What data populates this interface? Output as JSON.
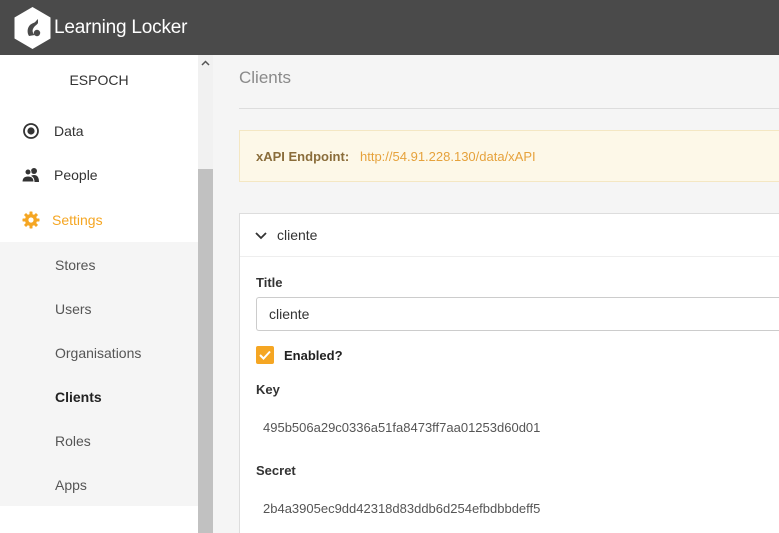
{
  "brand": {
    "name": "Learning Locker"
  },
  "sidebar": {
    "org": "ESPOCH",
    "nav": [
      {
        "label": "Data",
        "icon": "data-icon"
      },
      {
        "label": "People",
        "icon": "people-icon"
      },
      {
        "label": "Settings",
        "icon": "gear-icon"
      }
    ],
    "settings_items": [
      "Stores",
      "Users",
      "Organisations",
      "Clients",
      "Roles",
      "Apps"
    ],
    "current_item": "Clients"
  },
  "main": {
    "title": "Clients",
    "endpoint": {
      "label": "xAPI Endpoint:",
      "url": "http://54.91.228.130/data/xAPI"
    },
    "client": {
      "name": "cliente",
      "title_label": "Title",
      "title_value": "cliente",
      "enabled_label": "Enabled?",
      "enabled": true,
      "key_label": "Key",
      "key_value": "495b506a29c0336a51fa8473ff7aa01253d60d01",
      "secret_label": "Secret",
      "secret_value": "2b4a3905ec9dd42318d83ddb6d254efbdbbdeff5"
    }
  },
  "colors": {
    "topbar": "#4a4a4a",
    "accent": "#f5a623",
    "endpoint_bg": "#fdf8e8"
  }
}
